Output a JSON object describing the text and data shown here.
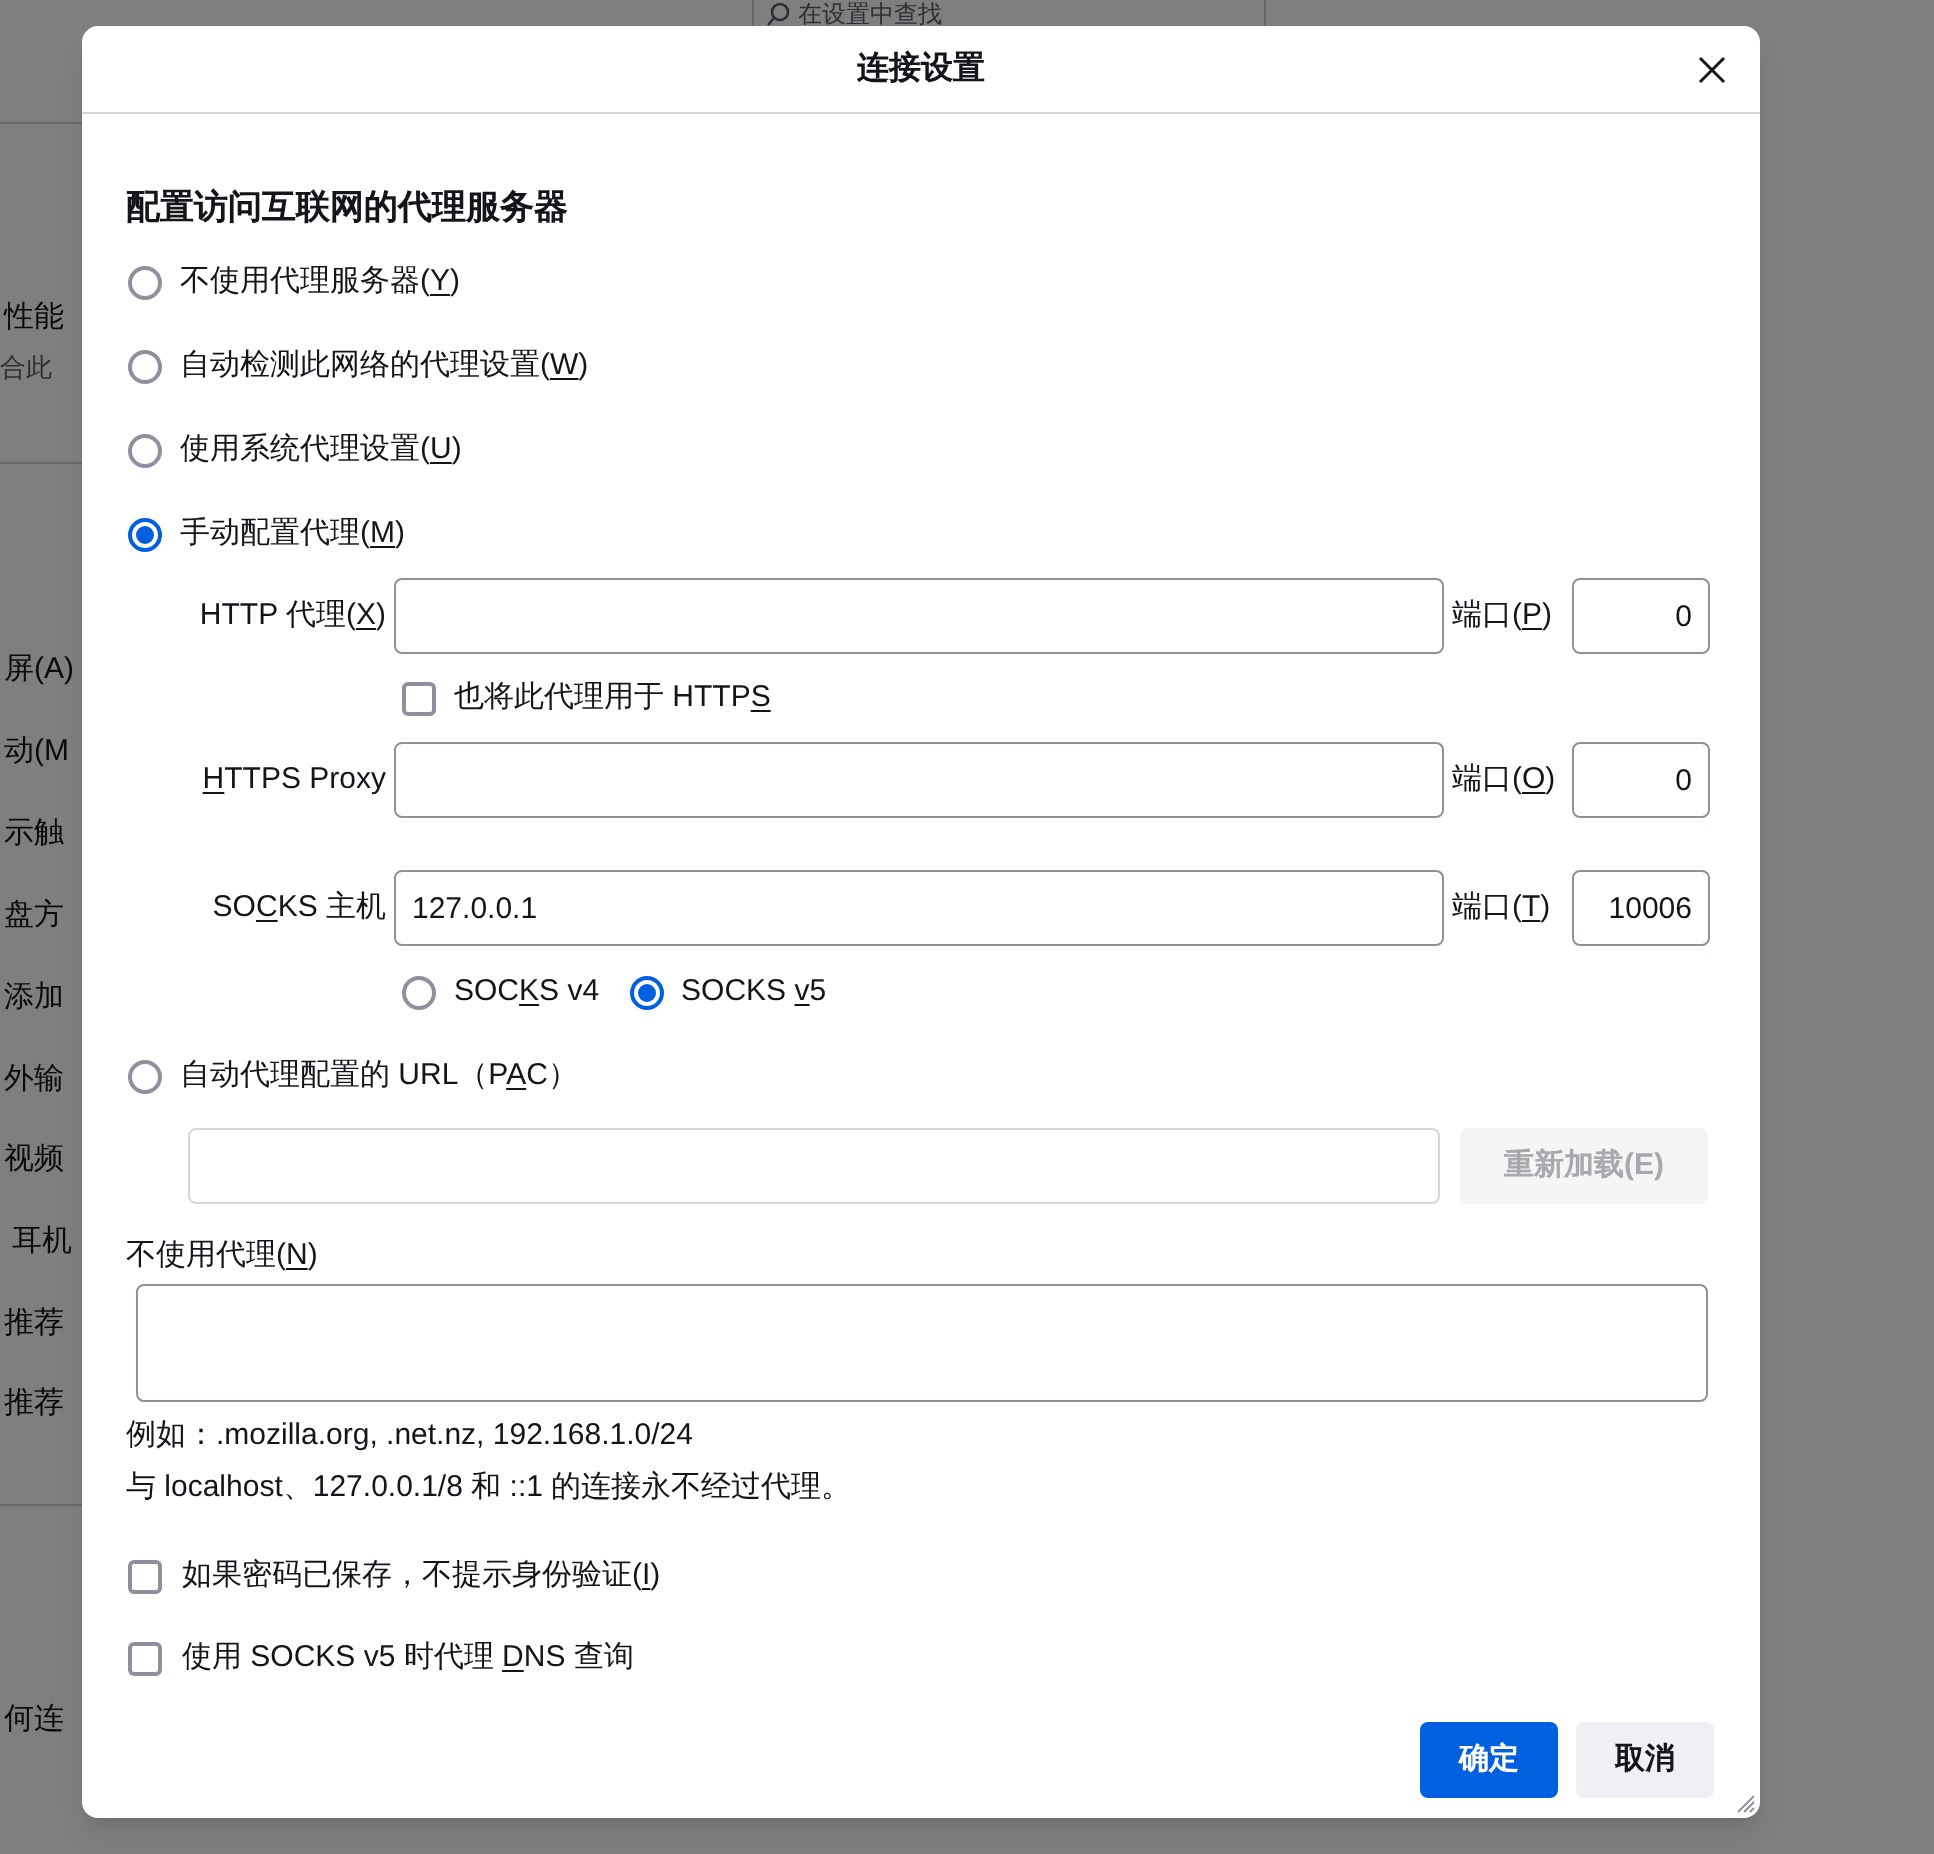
{
  "background_page": {
    "search": {
      "placeholder": "在设置中查找"
    },
    "fragments": [
      {
        "text": "性能",
        "kind": "main"
      },
      {
        "text": "合此",
        "kind": "sub"
      },
      {
        "text": "屏(A)",
        "kind": "main"
      },
      {
        "text": "动(M",
        "kind": "main"
      },
      {
        "text": "示触",
        "kind": "main"
      },
      {
        "text": "盘方",
        "kind": "main"
      },
      {
        "text": "添加",
        "kind": "main"
      },
      {
        "text": "外输",
        "kind": "main"
      },
      {
        "text": "视频",
        "kind": "main"
      },
      {
        "text": "耳机",
        "kind": "main"
      },
      {
        "text": "推荐",
        "kind": "main"
      },
      {
        "text": "推荐",
        "kind": "main"
      },
      {
        "text": "何连",
        "kind": "main"
      }
    ]
  },
  "dialog": {
    "title": "连接设置",
    "heading": "配置访问互联网的代理服务器",
    "proxy_modes": [
      {
        "kind": "none",
        "selected": false,
        "label": [
          {
            "text": "不使用代理服务器("
          },
          {
            "text": "Y",
            "underline": true
          },
          {
            "text": ")"
          }
        ]
      },
      {
        "kind": "auto_detect",
        "selected": false,
        "label": [
          {
            "text": "自动检测此网络的代理设置("
          },
          {
            "text": "W",
            "underline": true
          },
          {
            "text": ")"
          }
        ]
      },
      {
        "kind": "system",
        "selected": false,
        "label": [
          {
            "text": "使用系统代理设置("
          },
          {
            "text": "U",
            "underline": true
          },
          {
            "text": ")"
          }
        ]
      },
      {
        "kind": "manual",
        "selected": true,
        "label": [
          {
            "text": "手动配置代理("
          },
          {
            "text": "M",
            "underline": true
          },
          {
            "text": ")"
          }
        ]
      },
      {
        "kind": "pac",
        "selected": false,
        "disabled": true,
        "label": [
          {
            "text": "自动代理配置的 URL（P"
          },
          {
            "text": "A",
            "underline": true
          },
          {
            "text": "C）"
          }
        ]
      }
    ],
    "manual": {
      "http": {
        "label": [
          {
            "text": "HTTP 代理("
          },
          {
            "text": "X",
            "underline": true
          },
          {
            "text": ")"
          }
        ],
        "port_label": [
          {
            "text": "端口("
          },
          {
            "text": "P",
            "underline": true
          },
          {
            "text": ")"
          }
        ],
        "port": "0"
      },
      "also_https": {
        "checked": false,
        "label": [
          {
            "text": "也将此代理用于 HTTP"
          },
          {
            "text": "S",
            "underline": true
          }
        ]
      },
      "https": {
        "label": [
          {
            "text": "H",
            "underline": true
          },
          {
            "text": "TTPS Proxy"
          }
        ],
        "port_label": [
          {
            "text": "端口("
          },
          {
            "text": "O",
            "underline": true
          },
          {
            "text": ")"
          }
        ],
        "port": "0"
      },
      "socks": {
        "label": [
          {
            "text": "SO"
          },
          {
            "text": "C",
            "underline": true
          },
          {
            "text": "KS 主机"
          }
        ],
        "value": "127.0.0.1",
        "port_label": [
          {
            "text": "端口("
          },
          {
            "text": "T",
            "underline": true
          },
          {
            "text": ")"
          }
        ],
        "port": "10006"
      },
      "socks_versions": [
        {
          "selected": false,
          "label": [
            {
              "text": "SOC"
            },
            {
              "text": "K",
              "underline": true
            },
            {
              "text": "S v4"
            }
          ]
        },
        {
          "selected": true,
          "label": [
            {
              "text": "SOCKS "
            },
            {
              "text": "v",
              "underline": true
            },
            {
              "text": "5"
            }
          ]
        }
      ]
    },
    "pac": {
      "reload_button": "重新加载(E)"
    },
    "no_proxy": {
      "label": [
        {
          "text": "不使用代理("
        },
        {
          "text": "N",
          "underline": true
        },
        {
          "text": ")"
        }
      ]
    },
    "note_lines": [
      "例如：.mozilla.org, .net.nz, 192.168.1.0/24",
      "与 localhost、127.0.0.1/8 和 ::1 的连接永不经过代理。"
    ],
    "options": [
      {
        "checked": false,
        "label": [
          {
            "text": "如果密码已保存，不提示身份验证("
          },
          {
            "text": "I",
            "underline": true
          },
          {
            "text": ")"
          }
        ]
      },
      {
        "checked": false,
        "label": [
          {
            "text": "使用 SOCKS v5 时代理 "
          },
          {
            "text": "D",
            "underline": true
          },
          {
            "text": "NS 查询"
          }
        ]
      }
    ],
    "buttons": [
      {
        "label": "确定",
        "kind": "primary"
      },
      {
        "label": "取消",
        "kind": "secondary"
      }
    ]
  }
}
